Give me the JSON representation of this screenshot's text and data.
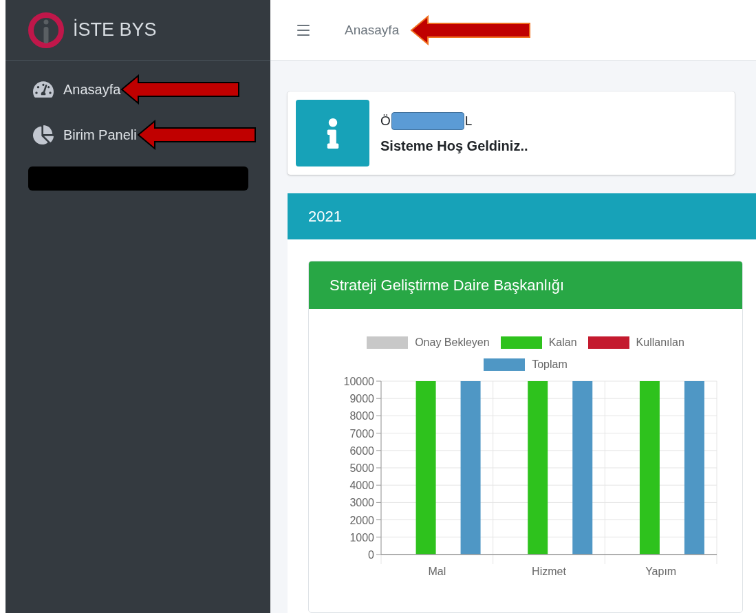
{
  "sidebar": {
    "brand": "İSTE BYS",
    "items": [
      {
        "label": "Anasayfa",
        "annotation_arrow": true
      },
      {
        "label": "Birim Paneli",
        "annotation_arrow": true
      }
    ],
    "redacted_bar": true
  },
  "header": {
    "title": "Anasayfa",
    "annotation_arrow": true
  },
  "welcome": {
    "name_start": "Ö",
    "name_end": "L",
    "name_redacted": true,
    "message": "Sisteme Hoş Geldiniz.."
  },
  "section": {
    "title": "2021",
    "card": {
      "title": "Strateji Geliştirme Daire Başkanlığı",
      "chart_data": {
        "type": "bar",
        "categories": [
          "Mal",
          "Hizmet",
          "Yapım"
        ],
        "series": [
          {
            "name": "Onay Bekleyen",
            "color": "#c8c8c8",
            "values": [
              0,
              0,
              0
            ]
          },
          {
            "name": "Kalan",
            "color": "#2ec21d",
            "values": [
              10000,
              10000,
              10000
            ]
          },
          {
            "name": "Kullanılan",
            "color": "#c41a2e",
            "values": [
              0,
              0,
              0
            ]
          },
          {
            "name": "Toplam",
            "color": "#4f97c5",
            "values": [
              10000,
              10000,
              10000
            ]
          }
        ],
        "grid": true,
        "legend": true,
        "ylim": [
          0,
          10000
        ],
        "yticks": [
          0,
          1000,
          2000,
          3000,
          4000,
          5000,
          6000,
          7000,
          8000,
          9000,
          10000
        ]
      }
    }
  }
}
